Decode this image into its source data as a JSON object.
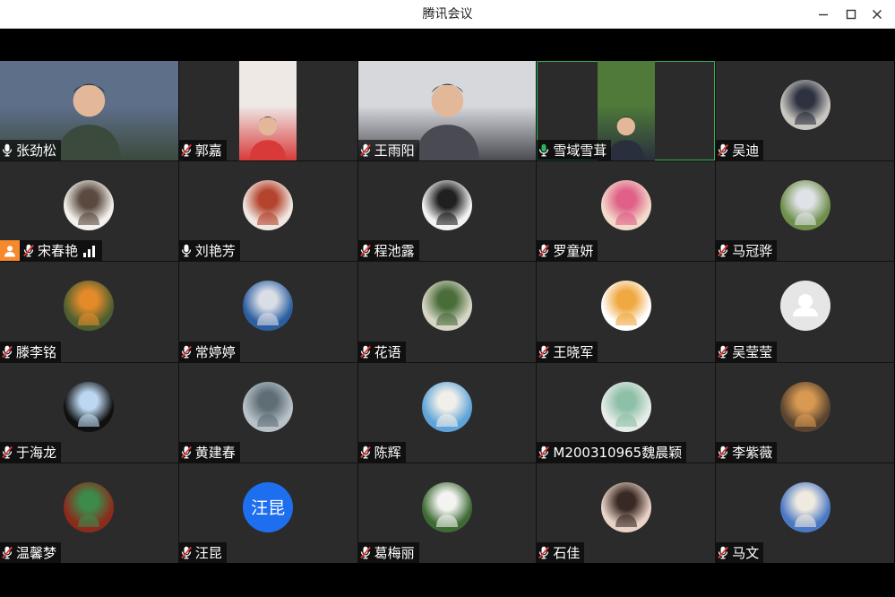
{
  "window": {
    "title": "腾讯会议"
  },
  "participants": [
    {
      "name": "张劲松",
      "mic": "on",
      "kind": "video",
      "colors": [
        "#5e6f8a",
        "#3b4a3c"
      ]
    },
    {
      "name": "郭嘉",
      "mic": "off",
      "kind": "video",
      "colors": [
        "#efe9e6",
        "#d83a3a"
      ]
    },
    {
      "name": "王雨阳",
      "mic": "off",
      "kind": "video",
      "colors": [
        "#d6d8dc",
        "#4a4a52"
      ]
    },
    {
      "name": "雪域雪茸",
      "mic": "speaking",
      "kind": "video",
      "colors": [
        "#4f7a3a",
        "#2a2f3d"
      ]
    },
    {
      "name": "吴迪",
      "mic": "off",
      "kind": "avatar",
      "colors": [
        "#c9c6c0",
        "#2d3140"
      ]
    },
    {
      "name": "宋春艳",
      "mic": "off",
      "kind": "avatar",
      "colors": [
        "#f4f1ec",
        "#5a4a40"
      ]
    },
    {
      "name": "刘艳芳",
      "mic": "on",
      "kind": "avatar",
      "colors": [
        "#efe7e0",
        "#b4442e"
      ]
    },
    {
      "name": "程池露",
      "mic": "off",
      "kind": "avatar",
      "colors": [
        "#f2f2f2",
        "#202020"
      ]
    },
    {
      "name": "罗童妍",
      "mic": "off",
      "kind": "avatar",
      "colors": [
        "#f2d9c9",
        "#e06088"
      ]
    },
    {
      "name": "马冠骅",
      "mic": "off",
      "kind": "avatar",
      "colors": [
        "#6f8f4c",
        "#dfe2e6"
      ]
    },
    {
      "name": "滕李铭",
      "mic": "off",
      "kind": "avatar",
      "colors": [
        "#4d5f30",
        "#e38a2a"
      ]
    },
    {
      "name": "常婷婷",
      "mic": "off",
      "kind": "avatar",
      "colors": [
        "#2d5fa0",
        "#d8dde6"
      ]
    },
    {
      "name": "花语",
      "mic": "off",
      "kind": "avatar",
      "colors": [
        "#d7d6c6",
        "#4a6d3a"
      ]
    },
    {
      "name": "王晓军",
      "mic": "off",
      "kind": "avatar",
      "colors": [
        "#ffffff",
        "#f0a840"
      ]
    },
    {
      "name": "吴莹莹",
      "mic": "off",
      "kind": "default",
      "colors": [
        "#e6e6e6",
        "#ffffff"
      ]
    },
    {
      "name": "于海龙",
      "mic": "off",
      "kind": "avatar",
      "colors": [
        "#101010",
        "#bcd8f0"
      ]
    },
    {
      "name": "黄建春",
      "mic": "off",
      "kind": "avatar",
      "colors": [
        "#b8c2c8",
        "#5f6e76"
      ]
    },
    {
      "name": "陈辉",
      "mic": "off",
      "kind": "avatar",
      "colors": [
        "#5fa3d8",
        "#f0efe9"
      ]
    },
    {
      "name": "M200310965魏晨颖",
      "mic": "off",
      "kind": "avatar",
      "colors": [
        "#e6ece8",
        "#8ec0a8"
      ]
    },
    {
      "name": "李紫薇",
      "mic": "off",
      "kind": "avatar",
      "colors": [
        "#5a4430",
        "#d89a52"
      ]
    },
    {
      "name": "温馨梦",
      "mic": "off",
      "kind": "avatar",
      "colors": [
        "#8c2a1c",
        "#3d8a4a"
      ]
    },
    {
      "name": "汪昆",
      "mic": "off",
      "kind": "text",
      "avatar_text": "汪昆",
      "colors": [
        "#1e6ff0",
        "#ffffff"
      ]
    },
    {
      "name": "葛梅丽",
      "mic": "off",
      "kind": "avatar",
      "colors": [
        "#3e6a34",
        "#f3f3f0"
      ]
    },
    {
      "name": "石佳",
      "mic": "off",
      "kind": "avatar",
      "colors": [
        "#e9d2c6",
        "#3a2a24"
      ]
    },
    {
      "name": "马文",
      "mic": "off",
      "kind": "avatar",
      "colors": [
        "#4a78c4",
        "#efeae0"
      ]
    }
  ],
  "host_index": 5,
  "signal_index": 5,
  "icons": {
    "mic_on": "mic-icon",
    "mic_off": "mic-muted-icon",
    "mic_speaking": "mic-speaking-icon",
    "host": "host-icon",
    "signal": "signal-icon",
    "minimize": "minimize-icon",
    "maximize": "maximize-icon",
    "close": "close-icon"
  },
  "colors": {
    "speaking": "#2fb35a",
    "host": "#f5892b",
    "muted": "#e03b3b"
  }
}
